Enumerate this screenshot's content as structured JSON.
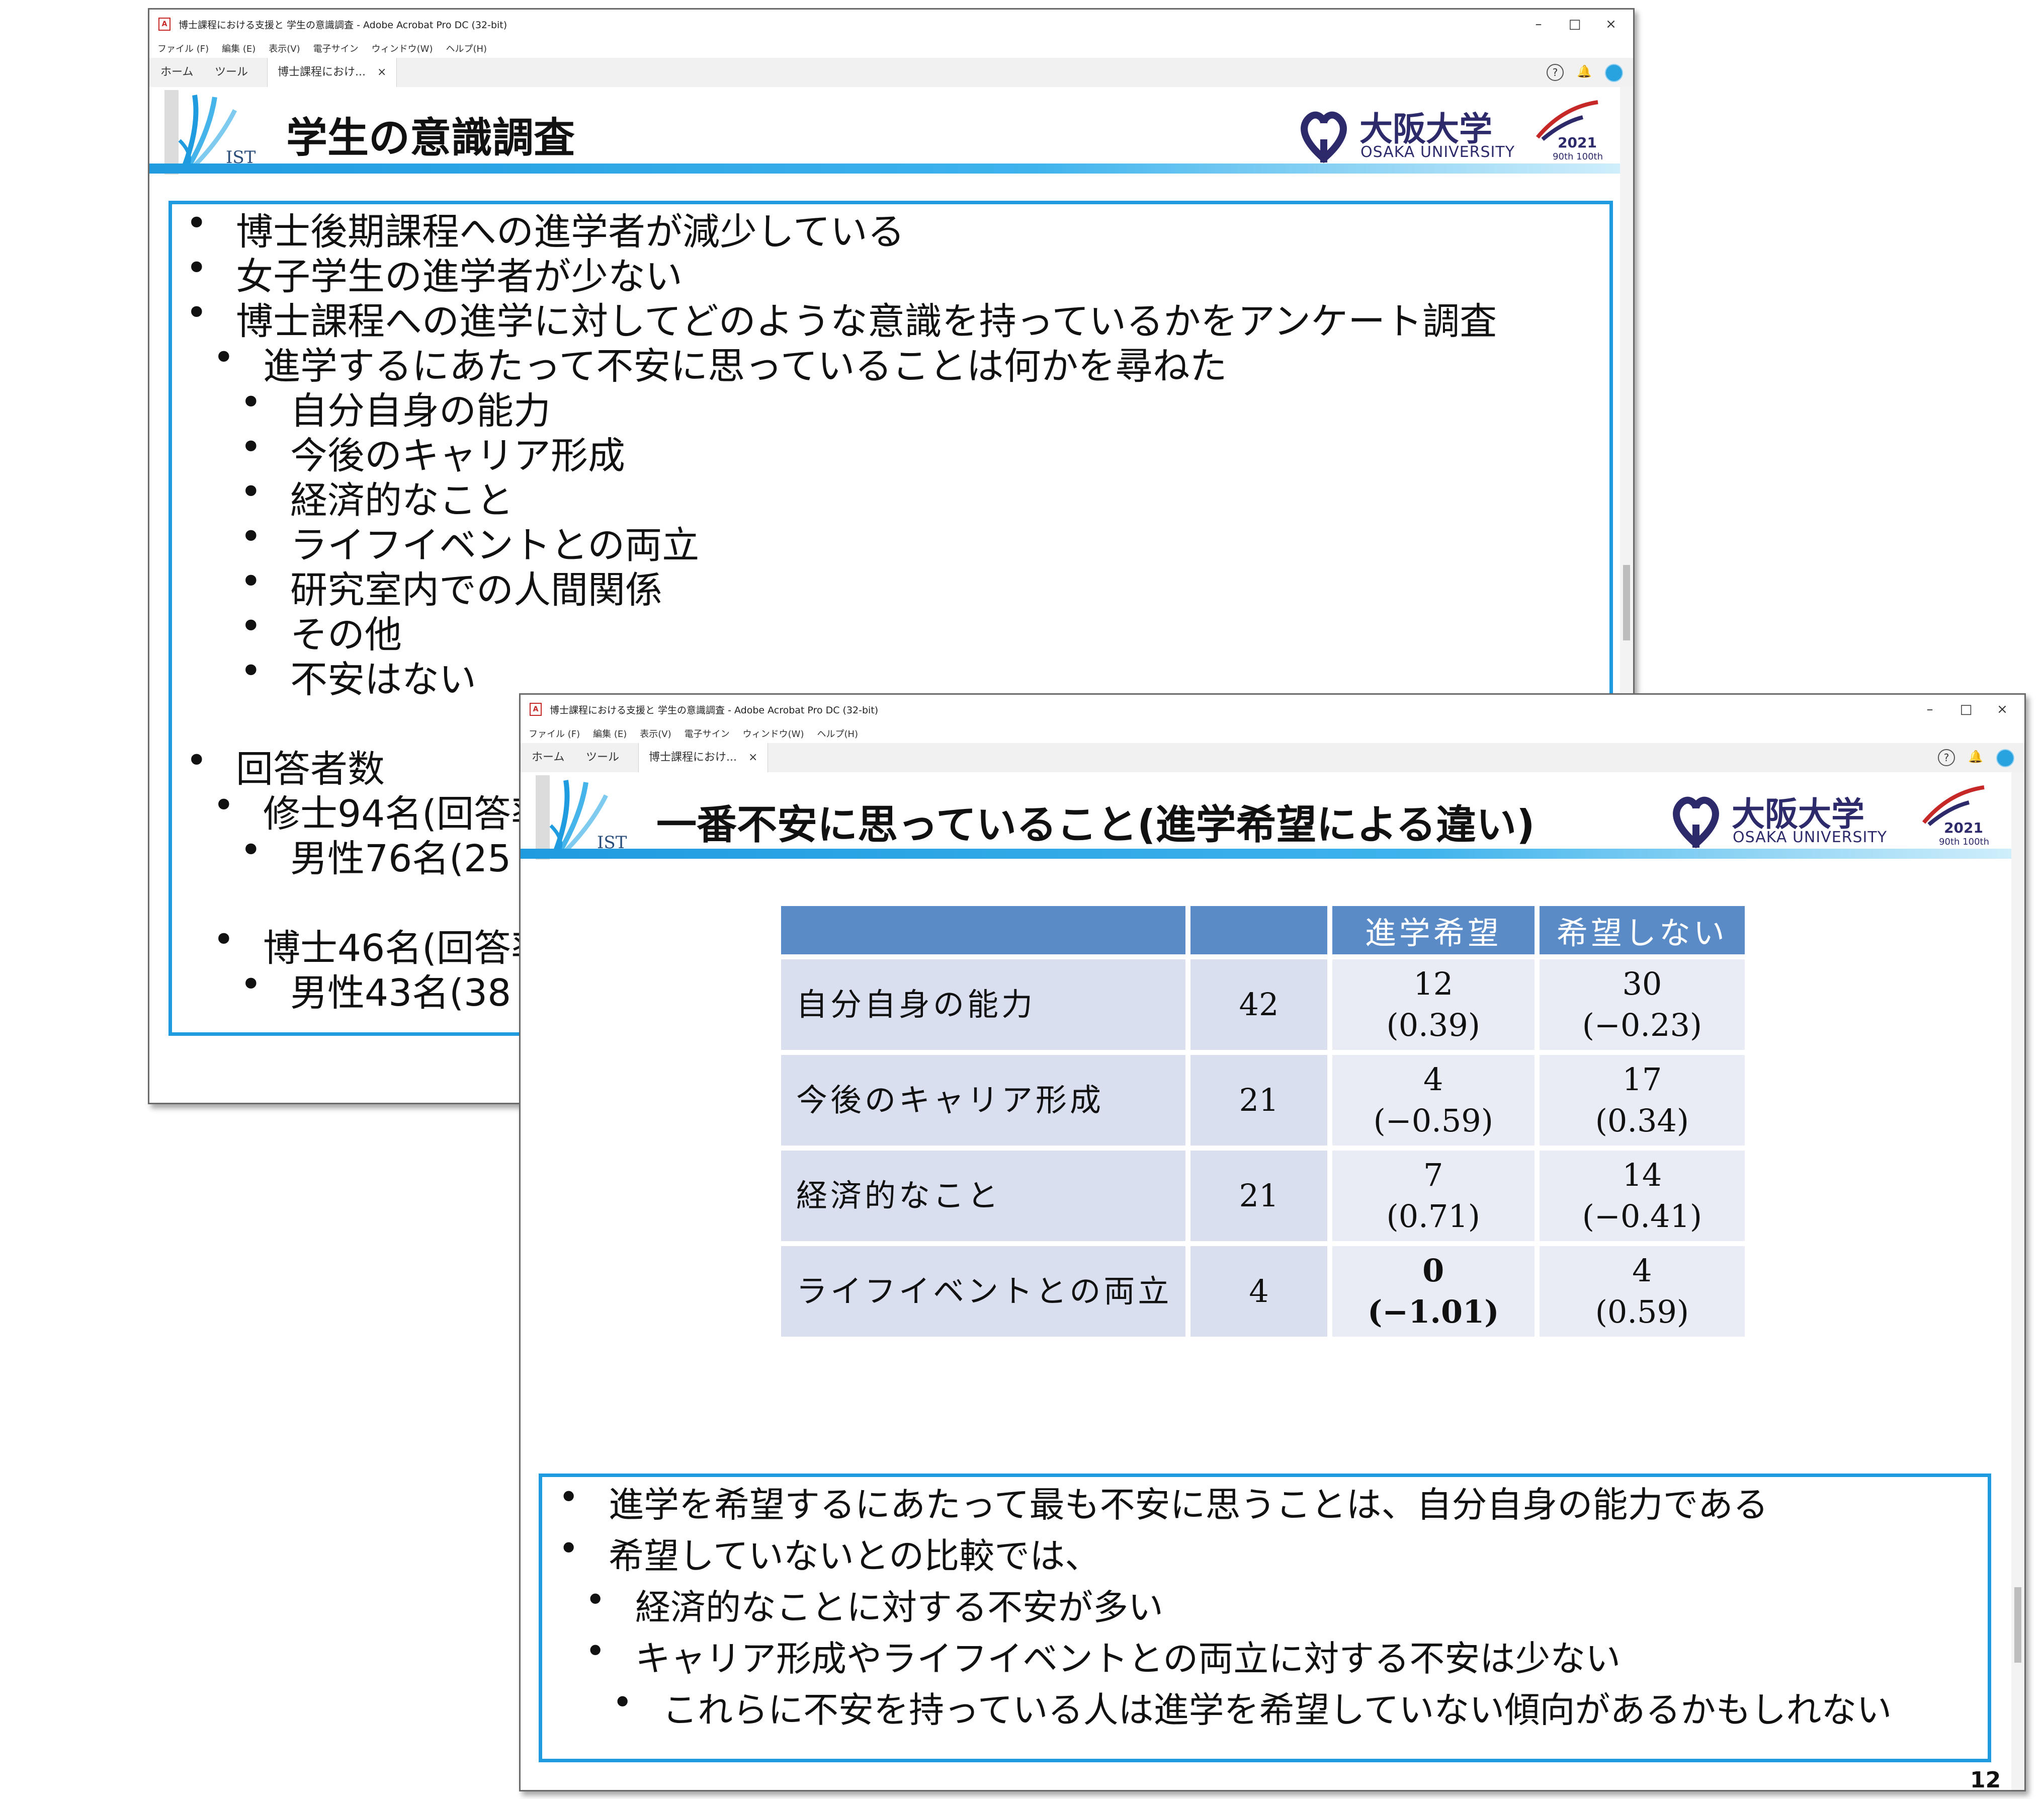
{
  "window_back": {
    "title": "博士課程における支援と 学生の意識調査 - Adobe Acrobat Pro DC (32-bit)",
    "menu": [
      "ファイル (F)",
      "編集 (E)",
      "表示(V)",
      "電子サイン",
      "ウィンドウ(W)",
      "ヘルプ(H)"
    ],
    "tabs": {
      "home": "ホーム",
      "tools": "ツール",
      "doc": "博士課程におけ..."
    },
    "slide": {
      "title": "学生の意識調査",
      "ist": "IST",
      "bullets": [
        "博士後期課程への進学者が減少している",
        "女子学生の進学者が少ない",
        "博士課程への進学に対してどのような意識を持っているかをアンケート調査",
        "進学するにあたって不安に思っていることは何かを尋ねた",
        "自分自身の能力",
        "今後のキャリア形成",
        "経済的なこと",
        "ライフイベントとの両立",
        "研究室内での人間関係",
        "その他",
        "不安はない",
        "回答者数",
        "修士94名(回答率",
        "男性76名(25",
        "博士46名(回答率",
        "男性43名(38"
      ]
    }
  },
  "window_front": {
    "title": "博士課程における支援と 学生の意識調査 - Adobe Acrobat Pro DC (32-bit)",
    "menu": [
      "ファイル (F)",
      "編集 (E)",
      "表示(V)",
      "電子サイン",
      "ウィンドウ(W)",
      "ヘルプ(H)"
    ],
    "tabs": {
      "home": "ホーム",
      "tools": "ツール",
      "doc": "博士課程におけ..."
    },
    "slide": {
      "title": "一番不安に思っていること(進学希望による違い)",
      "ist": "IST",
      "table": {
        "headers": [
          "",
          "",
          "進学希望",
          "希望しない"
        ],
        "rows": [
          {
            "label": "自分自身の能力",
            "total": "42",
            "a1": "12",
            "a2": "(0.39)",
            "b1": "30",
            "b2": "(−0.23)"
          },
          {
            "label": "今後のキャリア形成",
            "total": "21",
            "a1": "4",
            "a2": "(−0.59)",
            "b1": "17",
            "b2": "(0.34)"
          },
          {
            "label": "経済的なこと",
            "total": "21",
            "a1": "7",
            "a2": "(0.71)",
            "b1": "14",
            "b2": "(−0.41)"
          },
          {
            "label": "ライフイベントとの両立",
            "total": "4",
            "a1": "0",
            "a2": "(−1.01)",
            "b1": "4",
            "b2": "(0.59)"
          }
        ]
      },
      "summary": [
        "進学を希望するにあたって最も不安に思うことは、自分自身の能力である",
        "希望していないとの比較では、",
        "経済的なことに対する不安が多い",
        "キャリア形成やライフイベントとの両立に対する不安は少ない",
        "これらに不安を持っている人は進学を希望していない傾向があるかもしれない"
      ],
      "page_number": "12"
    }
  },
  "logo": {
    "univ_jp": "大阪大学",
    "univ_en": "OSAKA UNIVERSITY",
    "anniv_year": "2021",
    "anniv_sub": "90th 100th"
  },
  "glyphs": {
    "bullet": "•",
    "min": "–",
    "max": "□",
    "close": "×",
    "tab_close": "×",
    "help": "?",
    "bell": "🔔"
  },
  "colors": {
    "accent": "#1f9be0",
    "header_cell": "#5b8bc7",
    "cell": "#d9dfee",
    "negative_red": "#d2282d",
    "brand_navy": "#2c2a6a"
  }
}
